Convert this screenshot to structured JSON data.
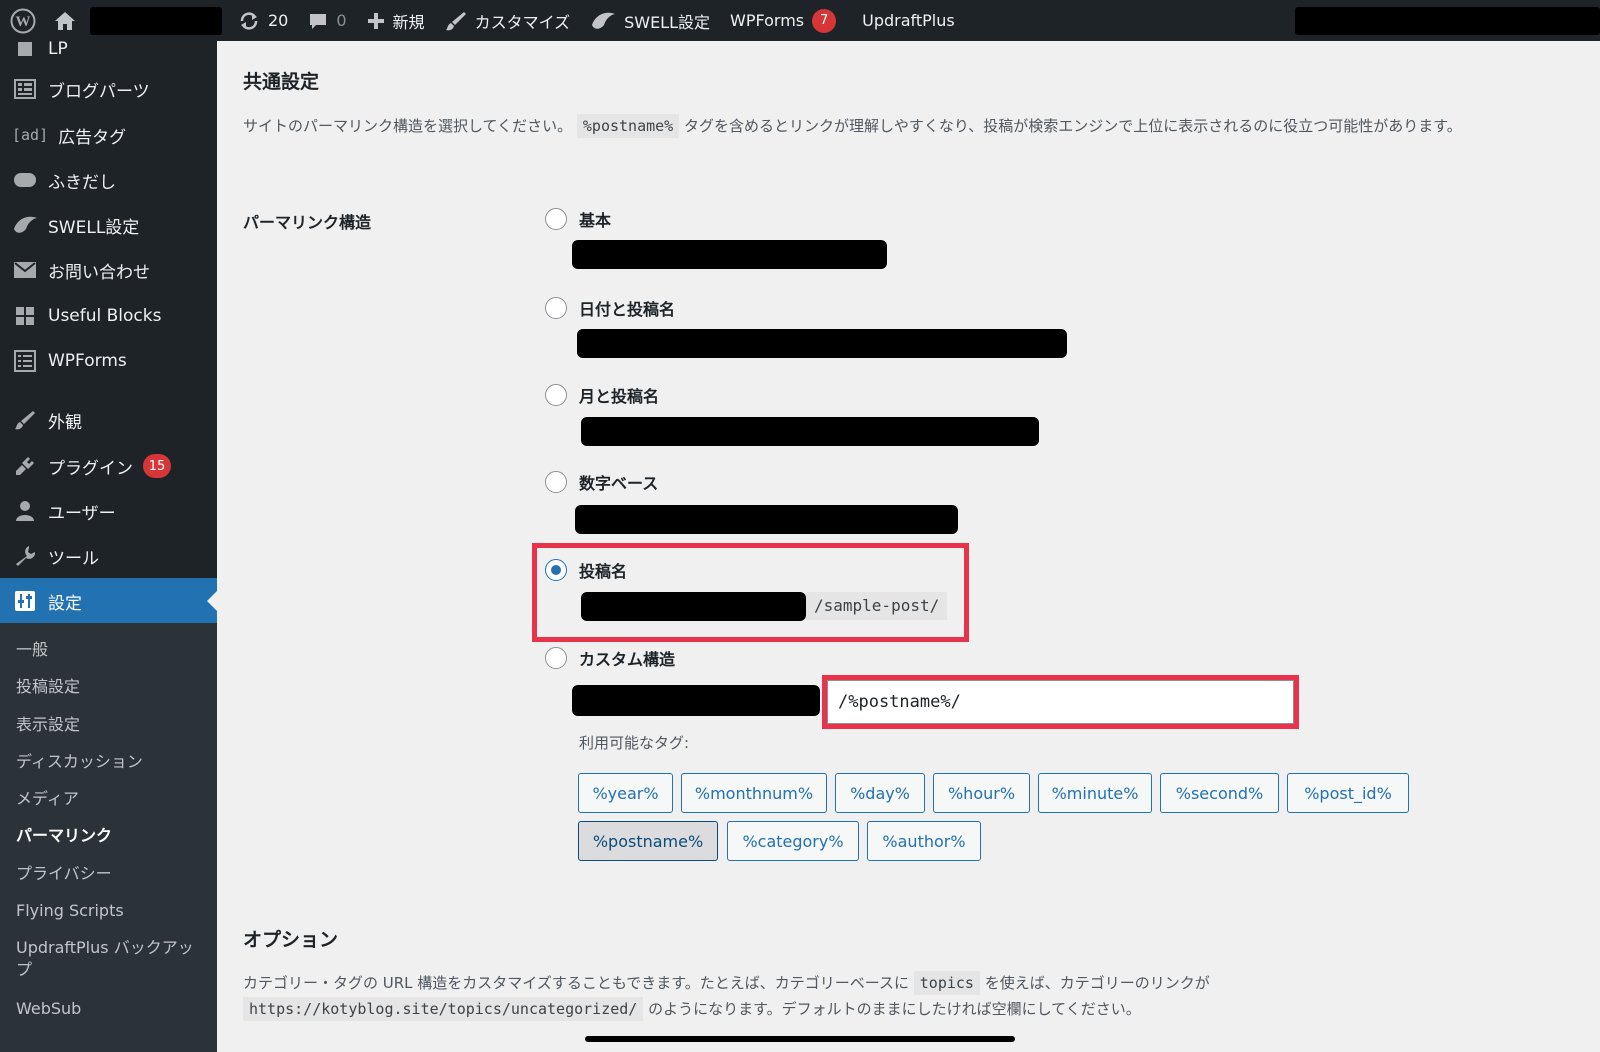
{
  "adminbar": {
    "updates_count": "20",
    "comments_count": "0",
    "new_label": "新規",
    "customize_label": "カスタマイズ",
    "swell_label": "SWELL設定",
    "wpforms_label": "WPForms",
    "wpforms_badge": "7",
    "updraft_label": "UpdraftPlus"
  },
  "sidebar": {
    "items": [
      {
        "label": "LP",
        "icon": "page-icon"
      },
      {
        "label": "ブログパーツ",
        "icon": "grid-icon"
      },
      {
        "label": "広告タグ",
        "icon": "ad-icon",
        "icon_text": "[ad]"
      },
      {
        "label": "ふきだし",
        "icon": "speech-bubble-icon"
      },
      {
        "label": "SWELL設定",
        "icon": "swell-icon"
      },
      {
        "label": "お問い合わせ",
        "icon": "mail-icon"
      },
      {
        "label": "Useful Blocks",
        "icon": "blocks-icon"
      },
      {
        "label": "WPForms",
        "icon": "form-icon"
      },
      {
        "label": "外観",
        "icon": "brush-icon"
      },
      {
        "label": "プラグイン",
        "icon": "plugin-icon",
        "badge": "15"
      },
      {
        "label": "ユーザー",
        "icon": "user-icon"
      },
      {
        "label": "ツール",
        "icon": "wrench-icon"
      },
      {
        "label": "設定",
        "icon": "settings-icon"
      }
    ],
    "submenu": [
      "一般",
      "投稿設定",
      "表示設定",
      "ディスカッション",
      "メディア",
      "パーマリンク",
      "プライバシー",
      "Flying Scripts",
      "UpdraftPlus バックアップ",
      "WebSub"
    ]
  },
  "main": {
    "common_title": "共通設定",
    "intro_before": "サイトのパーマリンク構造を選択してください。",
    "intro_code": "%postname%",
    "intro_after": "タグを含めるとリンクが理解しやすくなり、投稿が検索エンジンで上位に表示されるのに役立つ可能性があります。",
    "permalink_label": "パーマリンク構造",
    "options": [
      {
        "label": "基本",
        "checked": false
      },
      {
        "label": "日付と投稿名",
        "checked": false
      },
      {
        "label": "月と投稿名",
        "checked": false
      },
      {
        "label": "数字ベース",
        "checked": false
      },
      {
        "label": "投稿名",
        "checked": true
      },
      {
        "label": "カスタム構造",
        "checked": false
      }
    ],
    "postname_sample": "/sample-post/",
    "custom_value": "/%postname%/",
    "available_tags_label": "利用可能なタグ:",
    "tags": [
      "%year%",
      "%monthnum%",
      "%day%",
      "%hour%",
      "%minute%",
      "%second%",
      "%post_id%",
      "%postname%",
      "%category%",
      "%author%"
    ],
    "active_tag": "%postname%",
    "options_title": "オプション",
    "options_desc_before": "カテゴリー・タグの URL 構造をカスタマイズすることもできます。たとえば、カテゴリーベースに",
    "options_desc_code": "topics",
    "options_desc_after": "を使えば、カテゴリーのリンクが",
    "options_example_url": "https://kotyblog.site/topics/uncategorized/",
    "options_desc_end": "のようになります。デフォルトのままにしたければ空欄にしてください。"
  },
  "colors": {
    "accent": "#2271b1",
    "highlight": "#e8334a",
    "badge": "#d63638",
    "sidebar_bg": "#1d2327"
  }
}
